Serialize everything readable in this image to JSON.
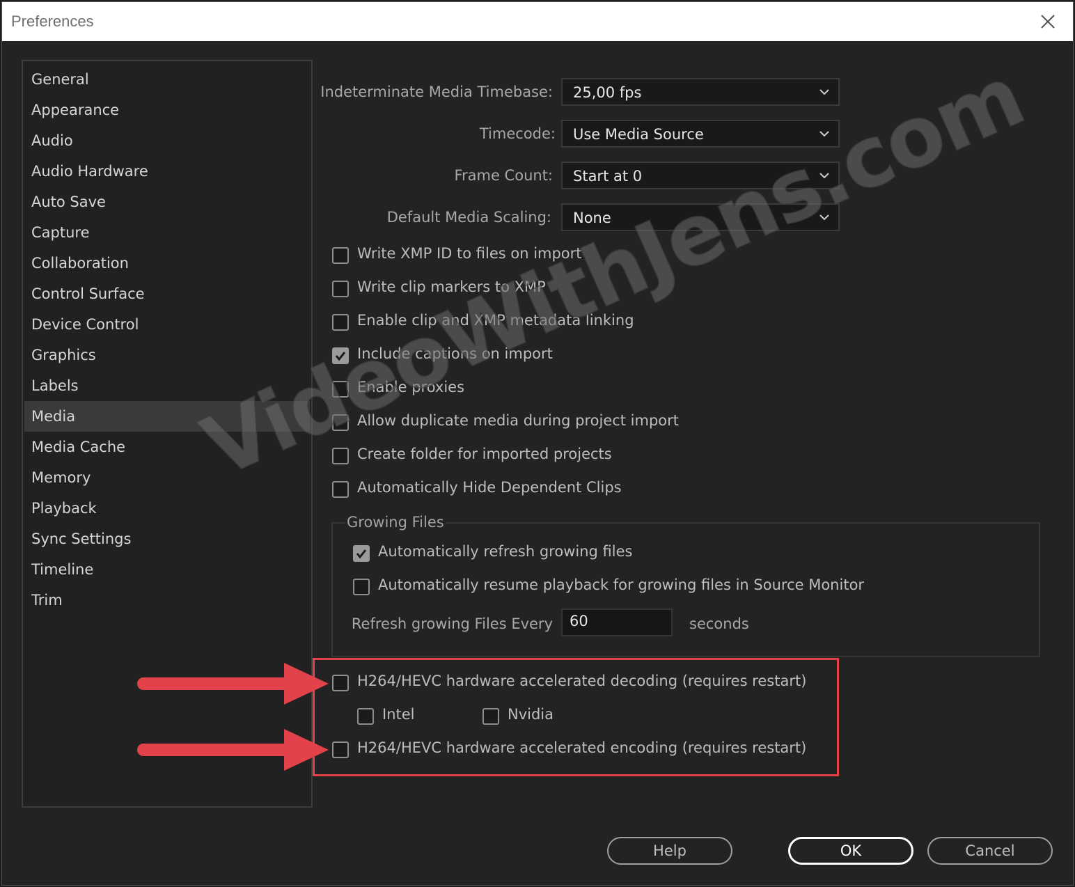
{
  "window": {
    "title": "Preferences",
    "close_icon": "close-icon"
  },
  "sidebar": {
    "items": [
      {
        "label": "General",
        "selected": false
      },
      {
        "label": "Appearance",
        "selected": false
      },
      {
        "label": "Audio",
        "selected": false
      },
      {
        "label": "Audio Hardware",
        "selected": false
      },
      {
        "label": "Auto Save",
        "selected": false
      },
      {
        "label": "Capture",
        "selected": false
      },
      {
        "label": "Collaboration",
        "selected": false
      },
      {
        "label": "Control Surface",
        "selected": false
      },
      {
        "label": "Device Control",
        "selected": false
      },
      {
        "label": "Graphics",
        "selected": false
      },
      {
        "label": "Labels",
        "selected": false
      },
      {
        "label": "Media",
        "selected": true
      },
      {
        "label": "Media Cache",
        "selected": false
      },
      {
        "label": "Memory",
        "selected": false
      },
      {
        "label": "Playback",
        "selected": false
      },
      {
        "label": "Sync Settings",
        "selected": false
      },
      {
        "label": "Timeline",
        "selected": false
      },
      {
        "label": "Trim",
        "selected": false
      }
    ]
  },
  "fields": {
    "timebase": {
      "label": "Indeterminate Media Timebase:",
      "value": "25,00 fps"
    },
    "timecode": {
      "label": "Timecode:",
      "value": "Use Media Source"
    },
    "frame_count": {
      "label": "Frame Count:",
      "value": "Start at 0"
    },
    "scaling": {
      "label": "Default Media Scaling:",
      "value": "None"
    }
  },
  "checkboxes": {
    "write_xmp": {
      "label": "Write XMP ID to files on import",
      "checked": false
    },
    "clip_markers": {
      "label": "Write clip markers to XMP",
      "checked": false
    },
    "metadata_linking": {
      "label": "Enable clip and XMP metadata linking",
      "checked": false
    },
    "captions": {
      "label": "Include captions on import",
      "checked": true
    },
    "proxies": {
      "label": "Enable proxies",
      "checked": false
    },
    "duplicate_media": {
      "label": "Allow duplicate media during project import",
      "checked": false
    },
    "create_folder": {
      "label": "Create folder for imported projects",
      "checked": false
    },
    "hide_dependent": {
      "label": "Automatically Hide Dependent Clips",
      "checked": false
    }
  },
  "growing_files": {
    "title": "Growing Files",
    "auto_refresh": {
      "label": "Automatically refresh growing files",
      "checked": true
    },
    "auto_resume": {
      "label": "Automatically resume playback for growing files in Source Monitor",
      "checked": false
    },
    "refresh_label": "Refresh growing Files Every",
    "refresh_value": "60",
    "refresh_unit": "seconds"
  },
  "hardware": {
    "decoding": {
      "label": "H264/HEVC hardware accelerated decoding (requires restart)",
      "checked": false
    },
    "intel": {
      "label": "Intel",
      "checked": false
    },
    "nvidia": {
      "label": "Nvidia",
      "checked": false
    },
    "encoding": {
      "label": "H264/HEVC hardware accelerated encoding (requires restart)",
      "checked": false
    }
  },
  "buttons": {
    "help": "Help",
    "ok": "OK",
    "cancel": "Cancel"
  },
  "watermark": "VideoWithJens.com",
  "colors": {
    "highlight": "#e2424a",
    "background": "#232323"
  }
}
